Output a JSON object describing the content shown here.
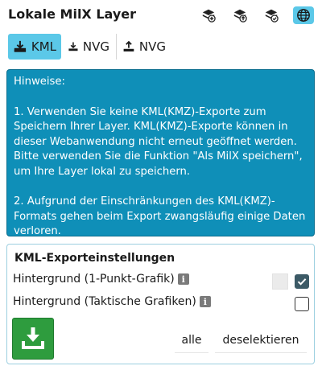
{
  "header": {
    "title": "Lokale MilX Layer",
    "icons": [
      "add-layer-icon",
      "layer-upload-icon",
      "layer-check-icon",
      "globe-icon"
    ],
    "active_icon": "globe-icon"
  },
  "tabs": [
    {
      "label": "KML",
      "icon": "download-icon",
      "active": true
    },
    {
      "label": "NVG",
      "icon": "download-icon",
      "active": false
    },
    {
      "label": "NVG",
      "icon": "upload-icon",
      "active": false
    }
  ],
  "notice": {
    "heading": "Hinweise:",
    "point1": "1. Verwenden Sie keine KML(KMZ)-Exporte zum Speichern Ihrer Layer. KML(KMZ)-Exporte können in dieser Webanwendung nicht erneut geöffnet werden. Bitte verwenden Sie die Funktion \"Als MilX speichern\", um Ihre Layer lokal zu speichern.",
    "point2": "2. Aufgrund der Einschränkungen des KML(KMZ)-Formats gehen beim Export zwangsläufig einige Daten verloren."
  },
  "settings": {
    "title": "KML-Exporteinstellungen",
    "option1": {
      "label": "Hintergrund (1-Punkt-Grafik)",
      "checked": true
    },
    "option2": {
      "label": "Hintergrund (Taktische Grafiken)",
      "checked": false
    },
    "info_glyph": "i",
    "select_all": "alle",
    "deselect": "deselektieren"
  },
  "colors": {
    "accent": "#5bc8e8",
    "notice_bg": "#0f8fb8",
    "download_btn": "#2e9c3e"
  }
}
